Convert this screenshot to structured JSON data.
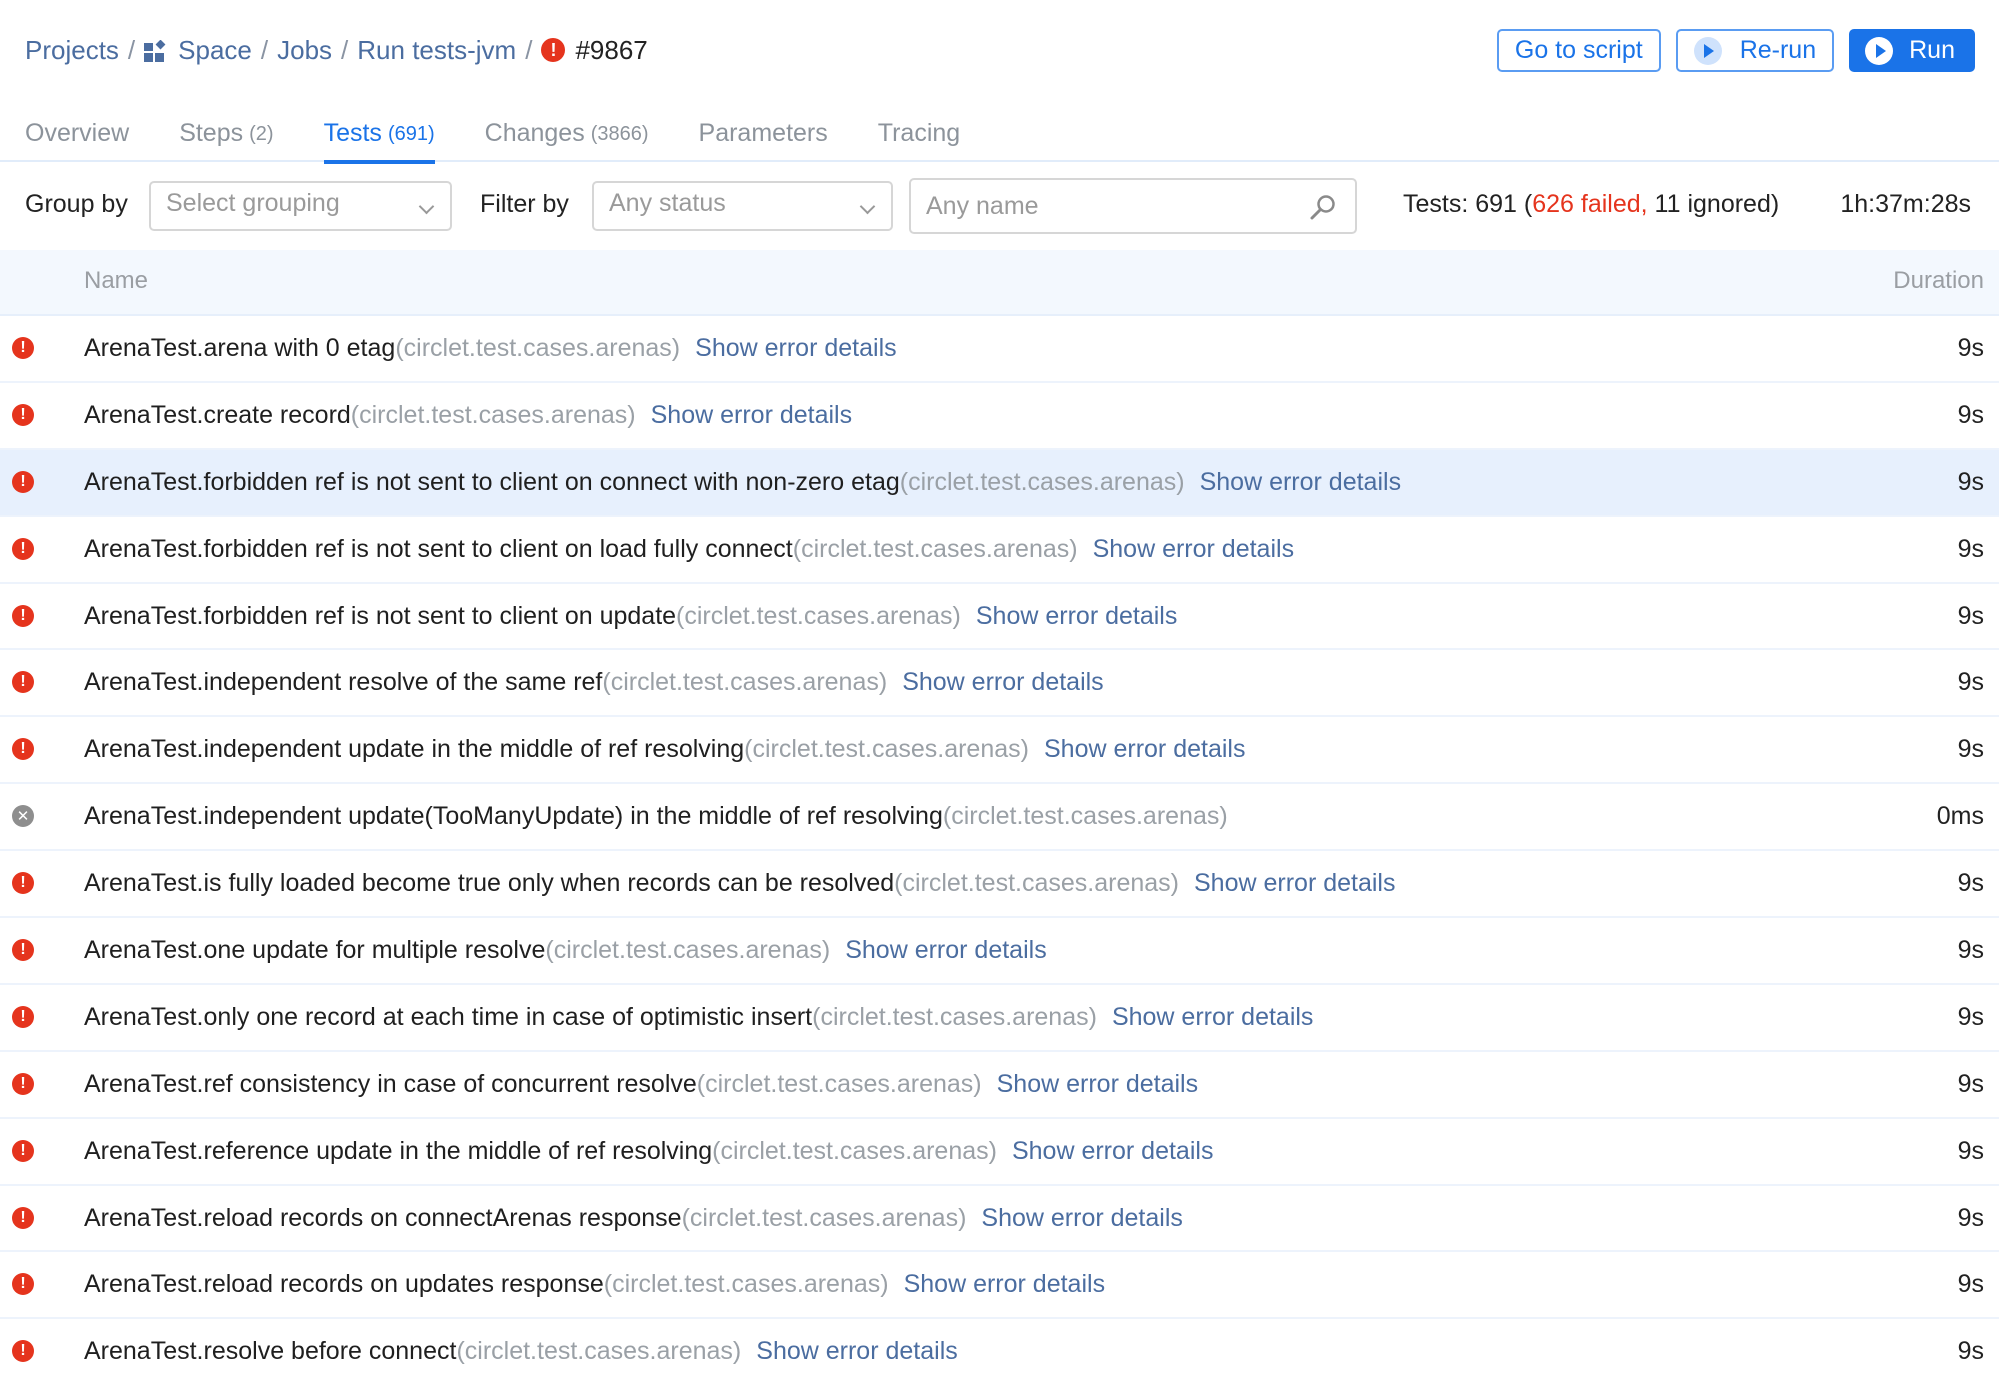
{
  "breadcrumb": {
    "items": [
      "Projects",
      "Space",
      "Jobs",
      "Run tests-jvm"
    ],
    "separator": "/",
    "run_status_icon": "error-icon",
    "run_number": "#9867"
  },
  "actions": {
    "go_to_script": "Go to script",
    "rerun": "Re-run",
    "run": "Run"
  },
  "tabs": [
    {
      "label": "Overview",
      "count": "",
      "active": false
    },
    {
      "label": "Steps",
      "count": "(2)",
      "active": false
    },
    {
      "label": "Tests",
      "count": "(691)",
      "active": true
    },
    {
      "label": "Changes",
      "count": "(3866)",
      "active": false
    },
    {
      "label": "Parameters",
      "count": "",
      "active": false
    },
    {
      "label": "Tracing",
      "count": "",
      "active": false
    }
  ],
  "filters": {
    "group_by_label": "Group by",
    "group_by_placeholder": "Select grouping",
    "filter_by_label": "Filter by",
    "status_placeholder": "Any status",
    "name_placeholder": "Any name"
  },
  "summary": {
    "prefix": "Tests: 691 (",
    "failed": "626 failed,",
    "suffix": " 11 ignored)",
    "total_time": "1h:37m:28s"
  },
  "table": {
    "columns": {
      "name": "Name",
      "duration": "Duration"
    },
    "link_label": "Show error details",
    "rows": [
      {
        "status": "failed",
        "name": "ArenaTest.arena with 0 etag",
        "package": "(circlet.test.cases.arenas)",
        "has_link": true,
        "duration": "9s"
      },
      {
        "status": "failed",
        "name": "ArenaTest.create record",
        "package": "(circlet.test.cases.arenas)",
        "has_link": true,
        "duration": "9s"
      },
      {
        "status": "failed",
        "name": "ArenaTest.forbidden ref is not sent to client on connect with non-zero etag",
        "package": "(circlet.test.cases.arenas)",
        "has_link": true,
        "duration": "9s",
        "highlighted": true
      },
      {
        "status": "failed",
        "name": "ArenaTest.forbidden ref is not sent to client on load fully connect",
        "package": "(circlet.test.cases.arenas)",
        "has_link": true,
        "duration": "9s"
      },
      {
        "status": "failed",
        "name": "ArenaTest.forbidden ref is not sent to client on update",
        "package": "(circlet.test.cases.arenas)",
        "has_link": true,
        "duration": "9s"
      },
      {
        "status": "failed",
        "name": "ArenaTest.independent resolve of the same ref",
        "package": "(circlet.test.cases.arenas)",
        "has_link": true,
        "duration": "9s"
      },
      {
        "status": "failed",
        "name": "ArenaTest.independent update in the middle of ref resolving",
        "package": "(circlet.test.cases.arenas)",
        "has_link": true,
        "duration": "9s"
      },
      {
        "status": "ignored",
        "name": "ArenaTest.independent update(TooManyUpdate) in the middle of ref resolving",
        "package": "(circlet.test.cases.arenas)",
        "has_link": false,
        "duration": "0ms"
      },
      {
        "status": "failed",
        "name": "ArenaTest.is fully loaded become true only when records can be resolved",
        "package": "(circlet.test.cases.arenas)",
        "has_link": true,
        "duration": "9s"
      },
      {
        "status": "failed",
        "name": "ArenaTest.one update for multiple resolve",
        "package": "(circlet.test.cases.arenas)",
        "has_link": true,
        "duration": "9s"
      },
      {
        "status": "failed",
        "name": "ArenaTest.only one record at each time in case of optimistic insert",
        "package": "(circlet.test.cases.arenas)",
        "has_link": true,
        "duration": "9s"
      },
      {
        "status": "failed",
        "name": "ArenaTest.ref consistency in case of concurrent resolve",
        "package": "(circlet.test.cases.arenas)",
        "has_link": true,
        "duration": "9s"
      },
      {
        "status": "failed",
        "name": "ArenaTest.reference update in the middle of ref resolving",
        "package": "(circlet.test.cases.arenas)",
        "has_link": true,
        "duration": "9s"
      },
      {
        "status": "failed",
        "name": "ArenaTest.reload records on connectArenas response",
        "package": "(circlet.test.cases.arenas)",
        "has_link": true,
        "duration": "9s"
      },
      {
        "status": "failed",
        "name": "ArenaTest.reload records on updates response",
        "package": "(circlet.test.cases.arenas)",
        "has_link": true,
        "duration": "9s"
      },
      {
        "status": "failed",
        "name": "ArenaTest.resolve before connect",
        "package": "(circlet.test.cases.arenas)",
        "has_link": true,
        "duration": "9s"
      }
    ]
  },
  "colors": {
    "accent": "#1a73e8",
    "link": "#4b6da0",
    "failed": "#e5341d",
    "ignored": "#8e8e8e",
    "highlight_row": "#e7f0fd",
    "header_bg": "#f3f8fe"
  }
}
